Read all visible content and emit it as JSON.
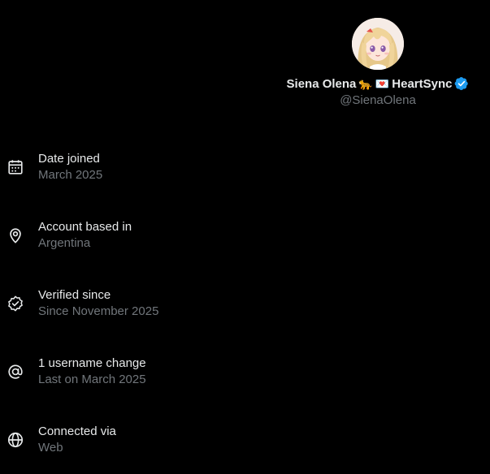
{
  "profile": {
    "display_name": "Siena Olena",
    "emoji_1": "🐆",
    "emoji_2": "💌",
    "name_suffix": "HeartSync",
    "handle": "@SienaOlena",
    "verified_color": "#1d9bf0"
  },
  "items": [
    {
      "icon": "calendar-icon",
      "label": "Date joined",
      "value": "March 2025"
    },
    {
      "icon": "location-pin-icon",
      "label": "Account based in",
      "value": "Argentina"
    },
    {
      "icon": "verified-badge-icon",
      "label": "Verified since",
      "value": "Since November 2025"
    },
    {
      "icon": "at-sign-icon",
      "label": "1 username change",
      "value": "Last on March 2025"
    },
    {
      "icon": "globe-icon",
      "label": "Connected via",
      "value": "Web"
    }
  ],
  "colors": {
    "background": "#000000",
    "primary_text": "#e7e9ea",
    "secondary_text": "#71767b"
  }
}
